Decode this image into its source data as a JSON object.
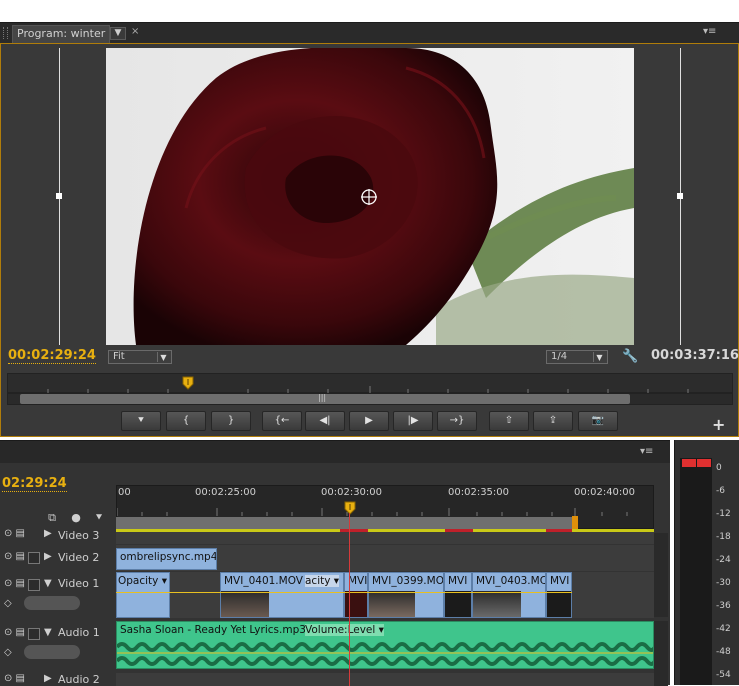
{
  "program_monitor": {
    "tab_title": "Program: winter",
    "tab_menu_icon": "chevron-down-icon",
    "close_glyph": "×",
    "panel_menu_glyph": "▾≡",
    "current_timecode": "00:02:29:24",
    "duration_timecode": "00:03:37:16",
    "zoom_select": "Fit",
    "resolution_select": "1/4",
    "transport_buttons": [
      {
        "name": "add-marker-button",
        "glyph": "⯆"
      },
      {
        "name": "mark-in-button",
        "glyph": "{"
      },
      {
        "name": "mark-out-button",
        "glyph": "}"
      },
      {
        "name": "go-to-in-button",
        "glyph": "{←"
      },
      {
        "name": "step-back-button",
        "glyph": "◀|"
      },
      {
        "name": "play-button",
        "glyph": "▶"
      },
      {
        "name": "step-forward-button",
        "glyph": "|▶"
      },
      {
        "name": "go-to-out-button",
        "glyph": "→}"
      },
      {
        "name": "lift-button",
        "glyph": "⇧"
      },
      {
        "name": "extract-button",
        "glyph": "⇪"
      },
      {
        "name": "export-frame-button",
        "glyph": "📷"
      }
    ],
    "add_button_glyph": "+",
    "scroll_thumb_glyph": "|||"
  },
  "timeline": {
    "menu_glyph": "▾≡",
    "current_timecode": "02:29:24",
    "ruler_labels": [
      "00",
      "00:02:25:00",
      "00:02:30:00",
      "00:02:35:00",
      "00:02:40:00"
    ],
    "tracks": {
      "video3": "Video 3",
      "video2": "Video 2",
      "video1": "Video 1",
      "audio1": "Audio 1",
      "audio2": "Audio 2"
    },
    "clips": {
      "v2_clip": "ombrelipsync.mp4",
      "v1_opacity": "Opacity ▾",
      "v1_clip_a": "MVI_0401.MOV",
      "v1_acity": "acity ▾",
      "v1_clip_b": "MVI",
      "v1_clip_c": "MVI_0399.MO",
      "v1_clip_d": "MVI",
      "v1_clip_e": "MVI_0403.MC",
      "v1_clip_f": "MVI",
      "a1_clip": "Sasha Sloan - Ready Yet Lyrics.mp3",
      "a1_volume": "Volume:Level ▾"
    }
  },
  "audio_meter": {
    "levels": [
      "0",
      "-6",
      "-12",
      "-18",
      "-24",
      "-30",
      "-36",
      "-42",
      "-48",
      "-54"
    ]
  },
  "colors": {
    "timecode_accent": "#e8b010",
    "video_clip": "#8fb2dd",
    "audio_clip": "#3fc58c",
    "playhead": "#d63a3a"
  }
}
